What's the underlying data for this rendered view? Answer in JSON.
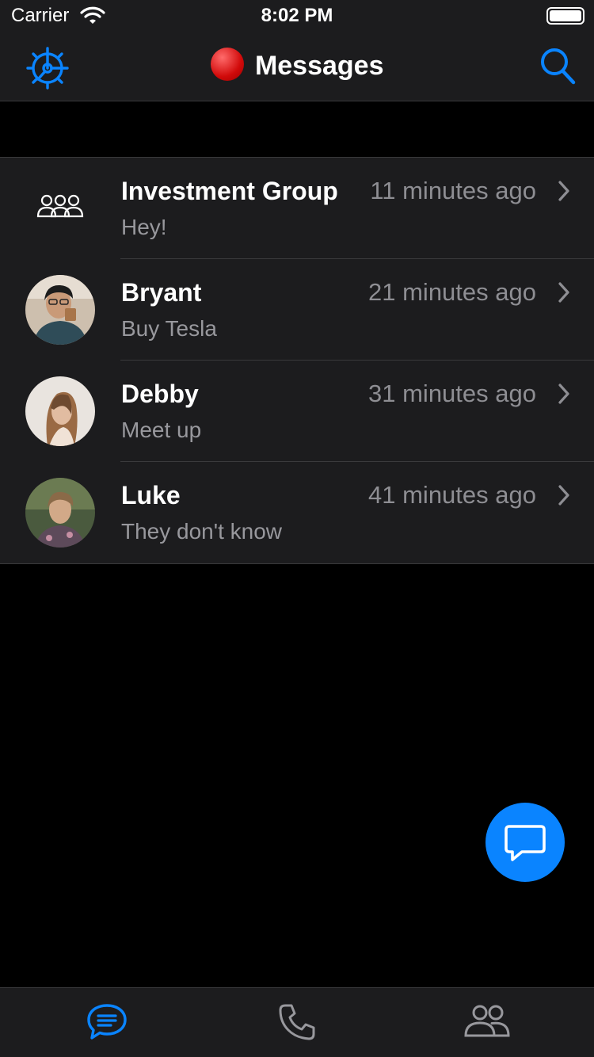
{
  "status_bar": {
    "carrier": "Carrier",
    "time": "8:02 PM"
  },
  "nav": {
    "title": "Messages",
    "settings_icon": "gear-icon",
    "search_icon": "search-icon",
    "accent": "#0a84ff"
  },
  "conversations": [
    {
      "name": "Investment Group",
      "time": "11 minutes ago",
      "preview": "Hey!",
      "avatar": "group-icon"
    },
    {
      "name": "Bryant",
      "time": "21 minutes ago",
      "preview": "Buy Tesla",
      "avatar": "photo"
    },
    {
      "name": "Debby",
      "time": "31 minutes ago",
      "preview": "Meet up",
      "avatar": "photo"
    },
    {
      "name": "Luke",
      "time": "41 minutes ago",
      "preview": "They don't know",
      "avatar": "photo"
    }
  ],
  "fab": {
    "icon": "new-message-icon"
  },
  "tabs": [
    {
      "id": "messages",
      "icon": "chat-bubble-icon",
      "active": true
    },
    {
      "id": "calls",
      "icon": "phone-icon",
      "active": false
    },
    {
      "id": "contacts",
      "icon": "people-icon",
      "active": false
    }
  ]
}
